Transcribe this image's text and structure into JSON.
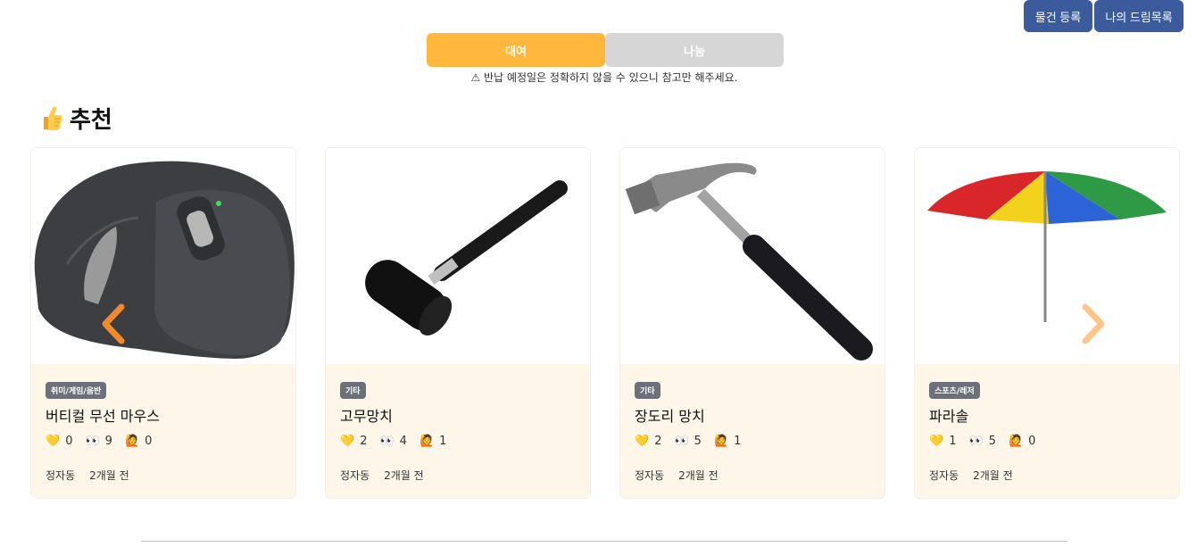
{
  "header": {
    "register_button": "물건 등록",
    "dream_list_button": "나의 드림목록"
  },
  "tabs": [
    {
      "label": "대여"
    },
    {
      "label": "나눔"
    }
  ],
  "notice": "⚠ 반납 예정일은 정확하지 않을 수 있으니 참고만 해주세요.",
  "section": {
    "title": "추천"
  },
  "cards": [
    {
      "category": "취미/게임/음반",
      "title": "버티컬 무선 마우스",
      "likes": "0",
      "views": "9",
      "requests": "0",
      "location": "정자동",
      "time": "2개월 전",
      "image": "mouse"
    },
    {
      "category": "기타",
      "title": "고무망치",
      "likes": "2",
      "views": "4",
      "requests": "1",
      "location": "정자동",
      "time": "2개월 전",
      "image": "rubber-mallet"
    },
    {
      "category": "기타",
      "title": "장도리 망치",
      "likes": "2",
      "views": "5",
      "requests": "1",
      "location": "정자동",
      "time": "2개월 전",
      "image": "claw-hammer"
    },
    {
      "category": "스포츠/레저",
      "title": "파라솔",
      "likes": "1",
      "views": "5",
      "requests": "0",
      "location": "정자동",
      "time": "2개월 전",
      "image": "parasol"
    }
  ],
  "icons": {
    "like": "yellow-heart-icon",
    "views": "eyes-icon",
    "request": "raising-hand-icon"
  },
  "colors": {
    "primary_button": "#3b5b9d",
    "tab_active": "#ffb83d",
    "tab_inactive": "#d6d6d6",
    "card_bg": "#fef6e9",
    "arrow": "#f5a04a"
  }
}
